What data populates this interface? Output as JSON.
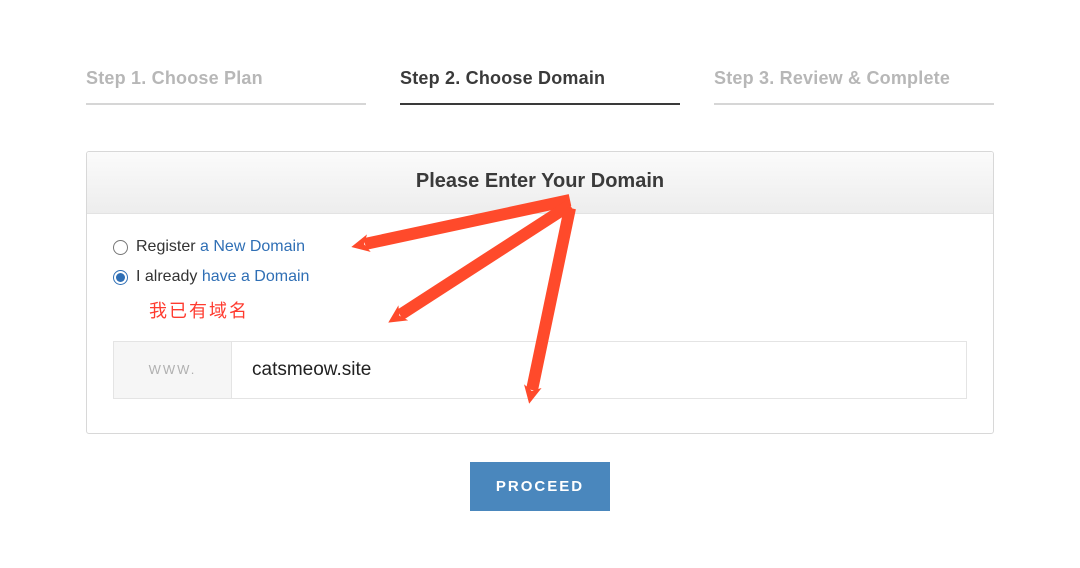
{
  "steps": {
    "s1": "Step 1. Choose Plan",
    "s2": "Step 2. Choose Domain",
    "s3": "Step 3. Review & Complete"
  },
  "panel": {
    "title": "Please Enter Your Domain",
    "radio_register_pre": "Register ",
    "radio_register_link": "a New Domain",
    "radio_have_pre": "I already ",
    "radio_have_link": "have a Domain",
    "chinese_note": "我已有域名",
    "prefix": "WWW.",
    "domain_value": "catsmeow.site",
    "proceed": "PROCEED"
  },
  "annotation": {
    "arrow_color": "#ff4a2b"
  }
}
